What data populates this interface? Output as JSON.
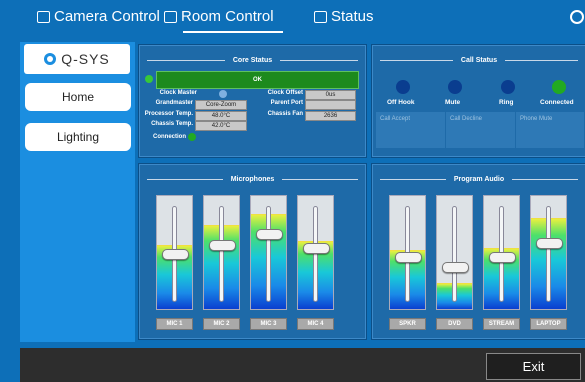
{
  "tabs": [
    {
      "label": "Camera Control",
      "icon": "camera-icon"
    },
    {
      "label": "Room Control",
      "icon": "panel-icon"
    },
    {
      "label": "Status",
      "icon": "waveform-icon"
    }
  ],
  "active_tab": "Room Control",
  "sidebar": {
    "logo": "Q-SYS",
    "items": [
      {
        "label": "Home"
      },
      {
        "label": "Lighting"
      }
    ]
  },
  "core_status": {
    "title": "Core Status",
    "status_text": "OK",
    "clock_master_label": "Clock Master",
    "clock_offset_label": "Clock Offset",
    "clock_offset": "0us",
    "grandmaster_label": "Grandmaster",
    "grandmaster": "Core-Zoom",
    "parent_port_label": "Parent Port",
    "parent_port": "",
    "processor_temp_label": "Processor Temp.",
    "processor_temp": "48.0°C",
    "chassis_fan_label": "Chassis Fan",
    "chassis_fan": "2636",
    "chassis_temp_label": "Chassis Temp.",
    "chassis_temp": "42.0°C",
    "connection_label": "Connection"
  },
  "call_status": {
    "title": "Call Status",
    "indicators": [
      {
        "label": "Off Hook",
        "active": false
      },
      {
        "label": "Mute",
        "active": false
      },
      {
        "label": "Ring",
        "active": false
      },
      {
        "label": "Connected",
        "active": true
      }
    ],
    "buttons": [
      {
        "label": "Call Accept"
      },
      {
        "label": "Call Decline"
      },
      {
        "label": "Phone Mute"
      }
    ]
  },
  "microphones": {
    "title": "Microphones",
    "channels": [
      {
        "label": "MIC 1",
        "level": 0.55,
        "fader": 0.43
      },
      {
        "label": "MIC 2",
        "level": 0.72,
        "fader": 0.5
      },
      {
        "label": "MIC 3",
        "level": 0.82,
        "fader": 0.6
      },
      {
        "label": "MIC 4",
        "level": 0.58,
        "fader": 0.48
      }
    ]
  },
  "program_audio": {
    "title": "Program Audio",
    "channels": [
      {
        "label": "SPKR",
        "level": 0.5,
        "fader": 0.4
      },
      {
        "label": "DVD",
        "level": 0.22,
        "fader": 0.31
      },
      {
        "label": "STREAM",
        "level": 0.52,
        "fader": 0.4
      },
      {
        "label": "LAPTOP",
        "level": 0.78,
        "fader": 0.52
      }
    ]
  },
  "exit_label": "Exit",
  "colors": {
    "background": "#0d6fb8",
    "panel": "#1e6aa8",
    "ok_green": "#1d8a1d",
    "led_off": "#0a3d8f",
    "led_on": "#22aa22"
  }
}
